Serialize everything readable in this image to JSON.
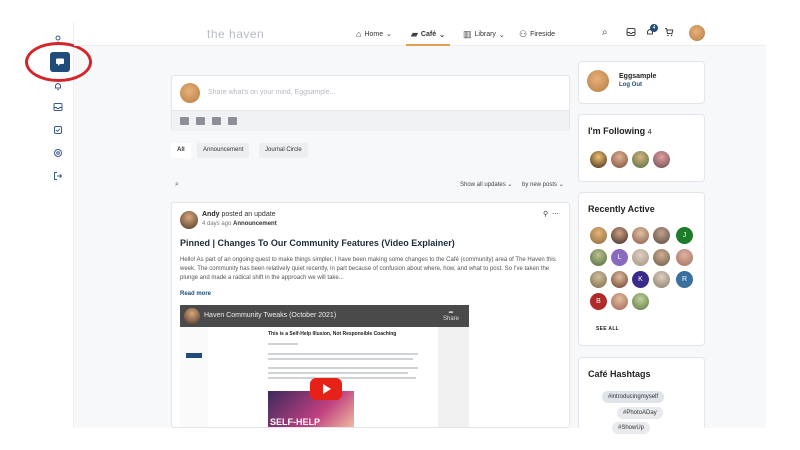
{
  "colors": {
    "brand": "#1f4c7a",
    "accent": "#e0a050",
    "annotation": "#d4262a"
  },
  "topnav": {
    "logo": "the haven",
    "items": [
      {
        "label": "Home",
        "icon": "home-icon",
        "dropdown": true
      },
      {
        "label": "Café",
        "icon": "chat-icon",
        "dropdown": true,
        "active": true
      },
      {
        "label": "Library",
        "icon": "library-icon",
        "dropdown": true
      },
      {
        "label": "Fireside",
        "icon": "people-icon",
        "dropdown": false
      }
    ],
    "notification_count": "4"
  },
  "sidebar": {
    "items": [
      "profile-icon",
      "chat-icon",
      "bell-icon",
      "inbox-icon",
      "checklist-icon",
      "settings-icon",
      "logout-icon"
    ],
    "active": "chat-icon"
  },
  "composer": {
    "placeholder": "Share what's on your mind, Eggsample..."
  },
  "tabs": [
    "All",
    "Announcement",
    "Journal Circle"
  ],
  "filters": {
    "show": "Show all updates",
    "sort": "by new posts"
  },
  "post": {
    "author": "Andy",
    "action": "posted an update",
    "time": "4 days ago",
    "category": "Announcement",
    "title": "Pinned | Changes To Our Community Features (Video Explainer)",
    "body": "Hello! As part of an ongoing quest to make things simpler, I have been making some changes to the Café (community) area of The Haven this week. The community has been relatively quiet recently, in part because of confusion about where, how, and what to post. So I've taken the plunge and made a radical shift in the approach we will take...",
    "read_more": "Read more",
    "video": {
      "title": "Haven Community Tweaks (October 2021)",
      "share": "Share",
      "page_heading": "This is a Self-Help Illusion, Not Responsible Coaching",
      "thumb_text": "SELF-HELP"
    }
  },
  "profile": {
    "name": "Eggsample",
    "logout": "Log Out"
  },
  "following": {
    "title": "I'm Following",
    "count": "4"
  },
  "recently_active": {
    "title": "Recently Active",
    "see_all": "SEE ALL",
    "letters": [
      "J",
      "L",
      "K",
      "R",
      "B"
    ]
  },
  "hashtags": {
    "title": "Café Hashtags",
    "tags": [
      "#introducingmyself",
      "#PhotoADay",
      "#ShowUp"
    ]
  }
}
